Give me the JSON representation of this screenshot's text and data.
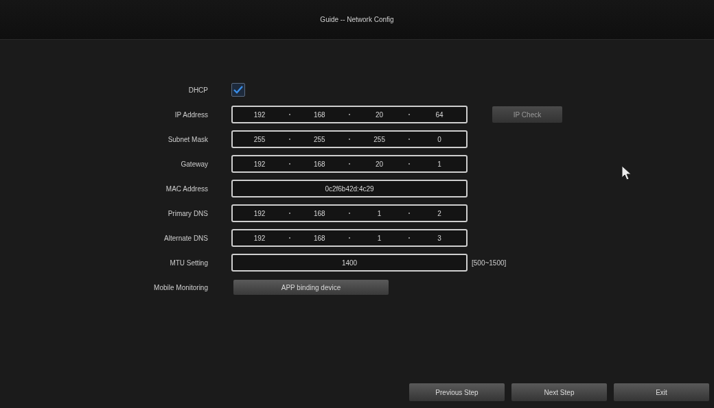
{
  "window": {
    "title": "Guide -- Network Config"
  },
  "rows": [
    {
      "kind": "checkbox",
      "label": "DHCP",
      "checked": true
    },
    {
      "kind": "ip",
      "label": "IP Address",
      "octets": [
        "192",
        "168",
        "20",
        "64"
      ],
      "side_button": {
        "label": "IP Check",
        "disabled": true
      }
    },
    {
      "kind": "ip",
      "label": "Subnet Mask",
      "octets": [
        "255",
        "255",
        "255",
        "0"
      ]
    },
    {
      "kind": "ip",
      "label": "Gateway",
      "octets": [
        "192",
        "168",
        "20",
        "1"
      ]
    },
    {
      "kind": "text",
      "label": "MAC Address",
      "value": "0c2f6b42d:4c29"
    },
    {
      "kind": "ip",
      "label": "Primary DNS",
      "octets": [
        "192",
        "168",
        "1",
        "2"
      ]
    },
    {
      "kind": "ip",
      "label": "Alternate DNS",
      "octets": [
        "192",
        "168",
        "1",
        "3"
      ]
    },
    {
      "kind": "text",
      "label": "MTU Setting",
      "value": "1400",
      "hint": "[500~1500]"
    },
    {
      "kind": "button",
      "label": "Mobile Monitoring",
      "button": "APP binding device"
    }
  ],
  "footer_buttons": [
    "Previous Step",
    "Next Step",
    "Exit"
  ]
}
